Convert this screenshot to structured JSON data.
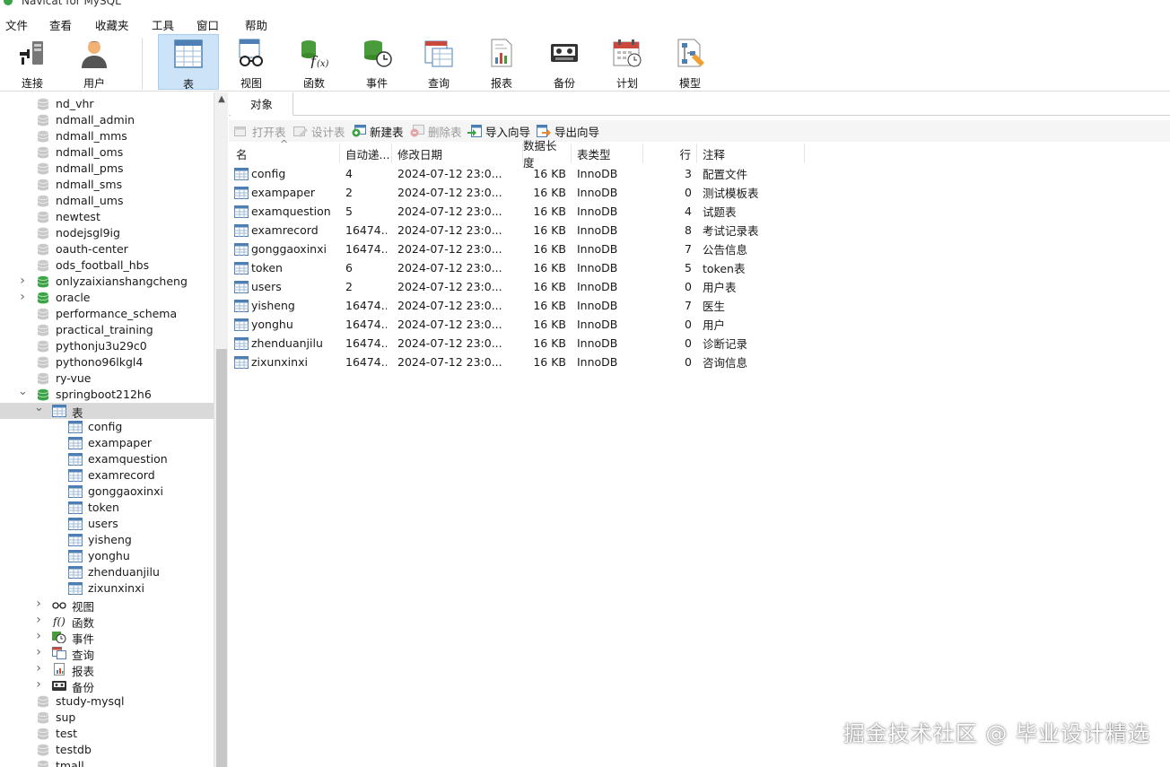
{
  "window": {
    "title": "Navicat for MySQL"
  },
  "menu": [
    "文件",
    "查看",
    "收藏夹",
    "工具",
    "窗口",
    "帮助"
  ],
  "toolbar": [
    {
      "label": "连接",
      "icon": "plug-icon"
    },
    {
      "label": "用户",
      "icon": "user-icon"
    },
    {
      "label": "表",
      "icon": "table-icon",
      "active": true
    },
    {
      "label": "视图",
      "icon": "glasses-icon"
    },
    {
      "label": "函数",
      "icon": "function-icon"
    },
    {
      "label": "事件",
      "icon": "event-clock-icon"
    },
    {
      "label": "查询",
      "icon": "query-icon"
    },
    {
      "label": "报表",
      "icon": "report-icon"
    },
    {
      "label": "备份",
      "icon": "backup-icon"
    },
    {
      "label": "计划",
      "icon": "calendar-icon"
    },
    {
      "label": "模型",
      "icon": "model-icon"
    }
  ],
  "sidebar": {
    "items": [
      {
        "label": "nd_vhr",
        "type": "db",
        "open": false,
        "level": 0
      },
      {
        "label": "ndmall_admin",
        "type": "db",
        "open": false,
        "level": 0
      },
      {
        "label": "ndmall_mms",
        "type": "db",
        "open": false,
        "level": 0
      },
      {
        "label": "ndmall_oms",
        "type": "db",
        "open": false,
        "level": 0
      },
      {
        "label": "ndmall_pms",
        "type": "db",
        "open": false,
        "level": 0
      },
      {
        "label": "ndmall_sms",
        "type": "db",
        "open": false,
        "level": 0
      },
      {
        "label": "ndmall_ums",
        "type": "db",
        "open": false,
        "level": 0
      },
      {
        "label": "newtest",
        "type": "db",
        "open": false,
        "level": 0
      },
      {
        "label": "nodejsgl9ig",
        "type": "db",
        "open": false,
        "level": 0
      },
      {
        "label": "oauth-center",
        "type": "db",
        "open": false,
        "level": 0
      },
      {
        "label": "ods_football_hbs",
        "type": "db",
        "open": false,
        "level": 0
      },
      {
        "label": "onlyzaixianshangcheng",
        "type": "db",
        "open": true,
        "level": 0,
        "chev": "›"
      },
      {
        "label": "oracle",
        "type": "db",
        "open": true,
        "level": 0,
        "chev": "›"
      },
      {
        "label": "performance_schema",
        "type": "db",
        "open": false,
        "level": 0
      },
      {
        "label": "practical_training",
        "type": "db",
        "open": false,
        "level": 0
      },
      {
        "label": "pythonju3u29c0",
        "type": "db",
        "open": false,
        "level": 0
      },
      {
        "label": "pythono96lkgl4",
        "type": "db",
        "open": false,
        "level": 0
      },
      {
        "label": "ry-vue",
        "type": "db",
        "open": false,
        "level": 0
      },
      {
        "label": "springboot212h6",
        "type": "db",
        "open": true,
        "level": 0,
        "chev": "⌄"
      },
      {
        "label": "表",
        "type": "folder-table",
        "level": 1,
        "chev": "⌄",
        "selected": true
      },
      {
        "label": "config",
        "type": "table",
        "level": 2
      },
      {
        "label": "exampaper",
        "type": "table",
        "level": 2
      },
      {
        "label": "examquestion",
        "type": "table",
        "level": 2
      },
      {
        "label": "examrecord",
        "type": "table",
        "level": 2
      },
      {
        "label": "gonggaoxinxi",
        "type": "table",
        "level": 2
      },
      {
        "label": "token",
        "type": "table",
        "level": 2
      },
      {
        "label": "users",
        "type": "table",
        "level": 2
      },
      {
        "label": "yisheng",
        "type": "table",
        "level": 2
      },
      {
        "label": "yonghu",
        "type": "table",
        "level": 2
      },
      {
        "label": "zhenduanjilu",
        "type": "table",
        "level": 2
      },
      {
        "label": "zixunxinxi",
        "type": "table",
        "level": 2
      },
      {
        "label": "视图",
        "type": "folder-view",
        "level": 1,
        "chev": "›"
      },
      {
        "label": "函数",
        "type": "folder-func",
        "level": 1,
        "chev": "›"
      },
      {
        "label": "事件",
        "type": "folder-event",
        "level": 1,
        "chev": "›"
      },
      {
        "label": "查询",
        "type": "folder-query",
        "level": 1,
        "chev": "›"
      },
      {
        "label": "报表",
        "type": "folder-report",
        "level": 1,
        "chev": "›"
      },
      {
        "label": "备份",
        "type": "folder-backup",
        "level": 1,
        "chev": "›"
      },
      {
        "label": "study-mysql",
        "type": "db",
        "open": false,
        "level": 0
      },
      {
        "label": "sup",
        "type": "db",
        "open": false,
        "level": 0
      },
      {
        "label": "test",
        "type": "db",
        "open": false,
        "level": 0
      },
      {
        "label": "testdb",
        "type": "db",
        "open": false,
        "level": 0
      },
      {
        "label": "tmall",
        "type": "db",
        "open": false,
        "level": 0
      }
    ]
  },
  "tabs": [
    {
      "label": "对象"
    }
  ],
  "actions": [
    {
      "label": "打开表",
      "disabled": true,
      "icon": "open-table-icon"
    },
    {
      "label": "设计表",
      "disabled": true,
      "icon": "design-table-icon"
    },
    {
      "label": "新建表",
      "disabled": false,
      "icon": "new-table-icon"
    },
    {
      "label": "删除表",
      "disabled": true,
      "icon": "delete-table-icon"
    },
    {
      "label": "导入向导",
      "disabled": false,
      "icon": "import-icon"
    },
    {
      "label": "导出向导",
      "disabled": false,
      "icon": "export-icon"
    }
  ],
  "columns": [
    "名",
    "自动递...",
    "修改日期",
    "数据长度",
    "表类型",
    "行",
    "注释"
  ],
  "rows": [
    {
      "name": "config",
      "auto": "4",
      "date": "2024-07-12 23:0...",
      "size": "16 KB",
      "engine": "InnoDB",
      "rows": "3",
      "comment": "配置文件"
    },
    {
      "name": "exampaper",
      "auto": "2",
      "date": "2024-07-12 23:0...",
      "size": "16 KB",
      "engine": "InnoDB",
      "rows": "0",
      "comment": "测试模板表"
    },
    {
      "name": "examquestion",
      "auto": "5",
      "date": "2024-07-12 23:0...",
      "size": "16 KB",
      "engine": "InnoDB",
      "rows": "4",
      "comment": "试题表"
    },
    {
      "name": "examrecord",
      "auto": "16474...",
      "date": "2024-07-12 23:0...",
      "size": "16 KB",
      "engine": "InnoDB",
      "rows": "8",
      "comment": "考试记录表"
    },
    {
      "name": "gonggaoxinxi",
      "auto": "16474...",
      "date": "2024-07-12 23:0...",
      "size": "16 KB",
      "engine": "InnoDB",
      "rows": "7",
      "comment": "公告信息"
    },
    {
      "name": "token",
      "auto": "6",
      "date": "2024-07-12 23:0...",
      "size": "16 KB",
      "engine": "InnoDB",
      "rows": "5",
      "comment": "token表"
    },
    {
      "name": "users",
      "auto": "2",
      "date": "2024-07-12 23:0...",
      "size": "16 KB",
      "engine": "InnoDB",
      "rows": "0",
      "comment": "用户表"
    },
    {
      "name": "yisheng",
      "auto": "16474...",
      "date": "2024-07-12 23:0...",
      "size": "16 KB",
      "engine": "InnoDB",
      "rows": "7",
      "comment": "医生"
    },
    {
      "name": "yonghu",
      "auto": "16474...",
      "date": "2024-07-12 23:0...",
      "size": "16 KB",
      "engine": "InnoDB",
      "rows": "0",
      "comment": "用户"
    },
    {
      "name": "zhenduanjilu",
      "auto": "16474...",
      "date": "2024-07-12 23:0...",
      "size": "16 KB",
      "engine": "InnoDB",
      "rows": "0",
      "comment": "诊断记录"
    },
    {
      "name": "zixunxinxi",
      "auto": "16474...",
      "date": "2024-07-12 23:0...",
      "size": "16 KB",
      "engine": "InnoDB",
      "rows": "0",
      "comment": "咨询信息"
    }
  ],
  "watermark": "掘金技术社区 @ 毕业设计精选",
  "colors": {
    "accent": "#cde3f7",
    "db_active": "#3aa346",
    "db_inactive": "#c8c8c8",
    "table_icon": "#4d7fb4"
  }
}
